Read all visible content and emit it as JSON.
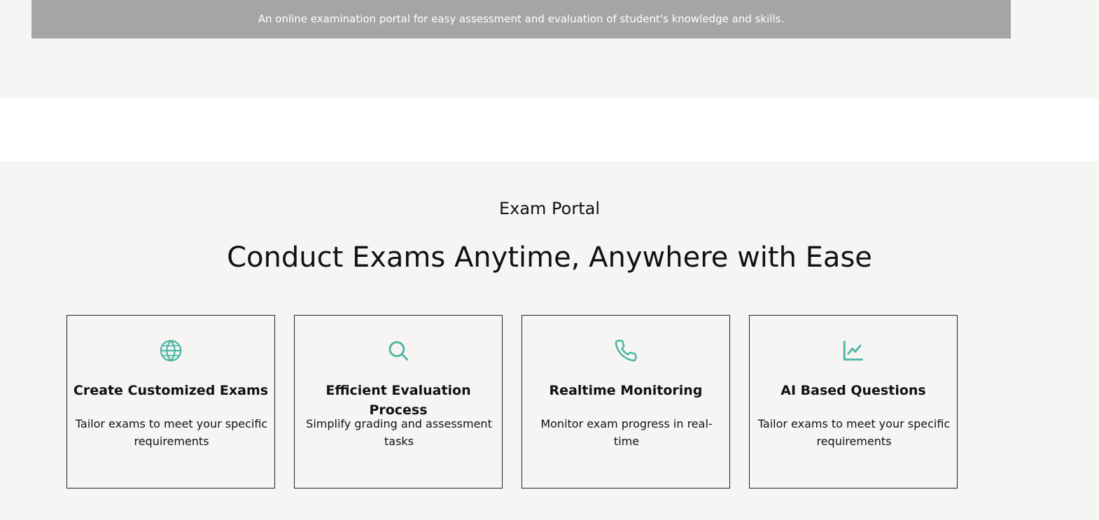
{
  "banner": {
    "text": "An online examination portal for easy assessment and evaluation of student's knowledge and skills."
  },
  "features": {
    "eyebrow": "Exam Portal",
    "headline": "Conduct Exams Anytime, Anywhere with Ease",
    "icon_color": "#4db6a4",
    "cards": [
      {
        "icon": "globe-icon",
        "title": "Create Customized Exams",
        "description": "Tailor exams to meet your specific requirements"
      },
      {
        "icon": "search-icon",
        "title": "Efficient Evaluation Process",
        "description": "Simplify grading and assessment tasks"
      },
      {
        "icon": "phone-icon",
        "title": "Realtime Monitoring",
        "description": "Monitor exam progress in real-time"
      },
      {
        "icon": "line-chart-icon",
        "title": "AI Based Questions",
        "description": "Tailor exams to meet your specific requirements"
      }
    ]
  }
}
